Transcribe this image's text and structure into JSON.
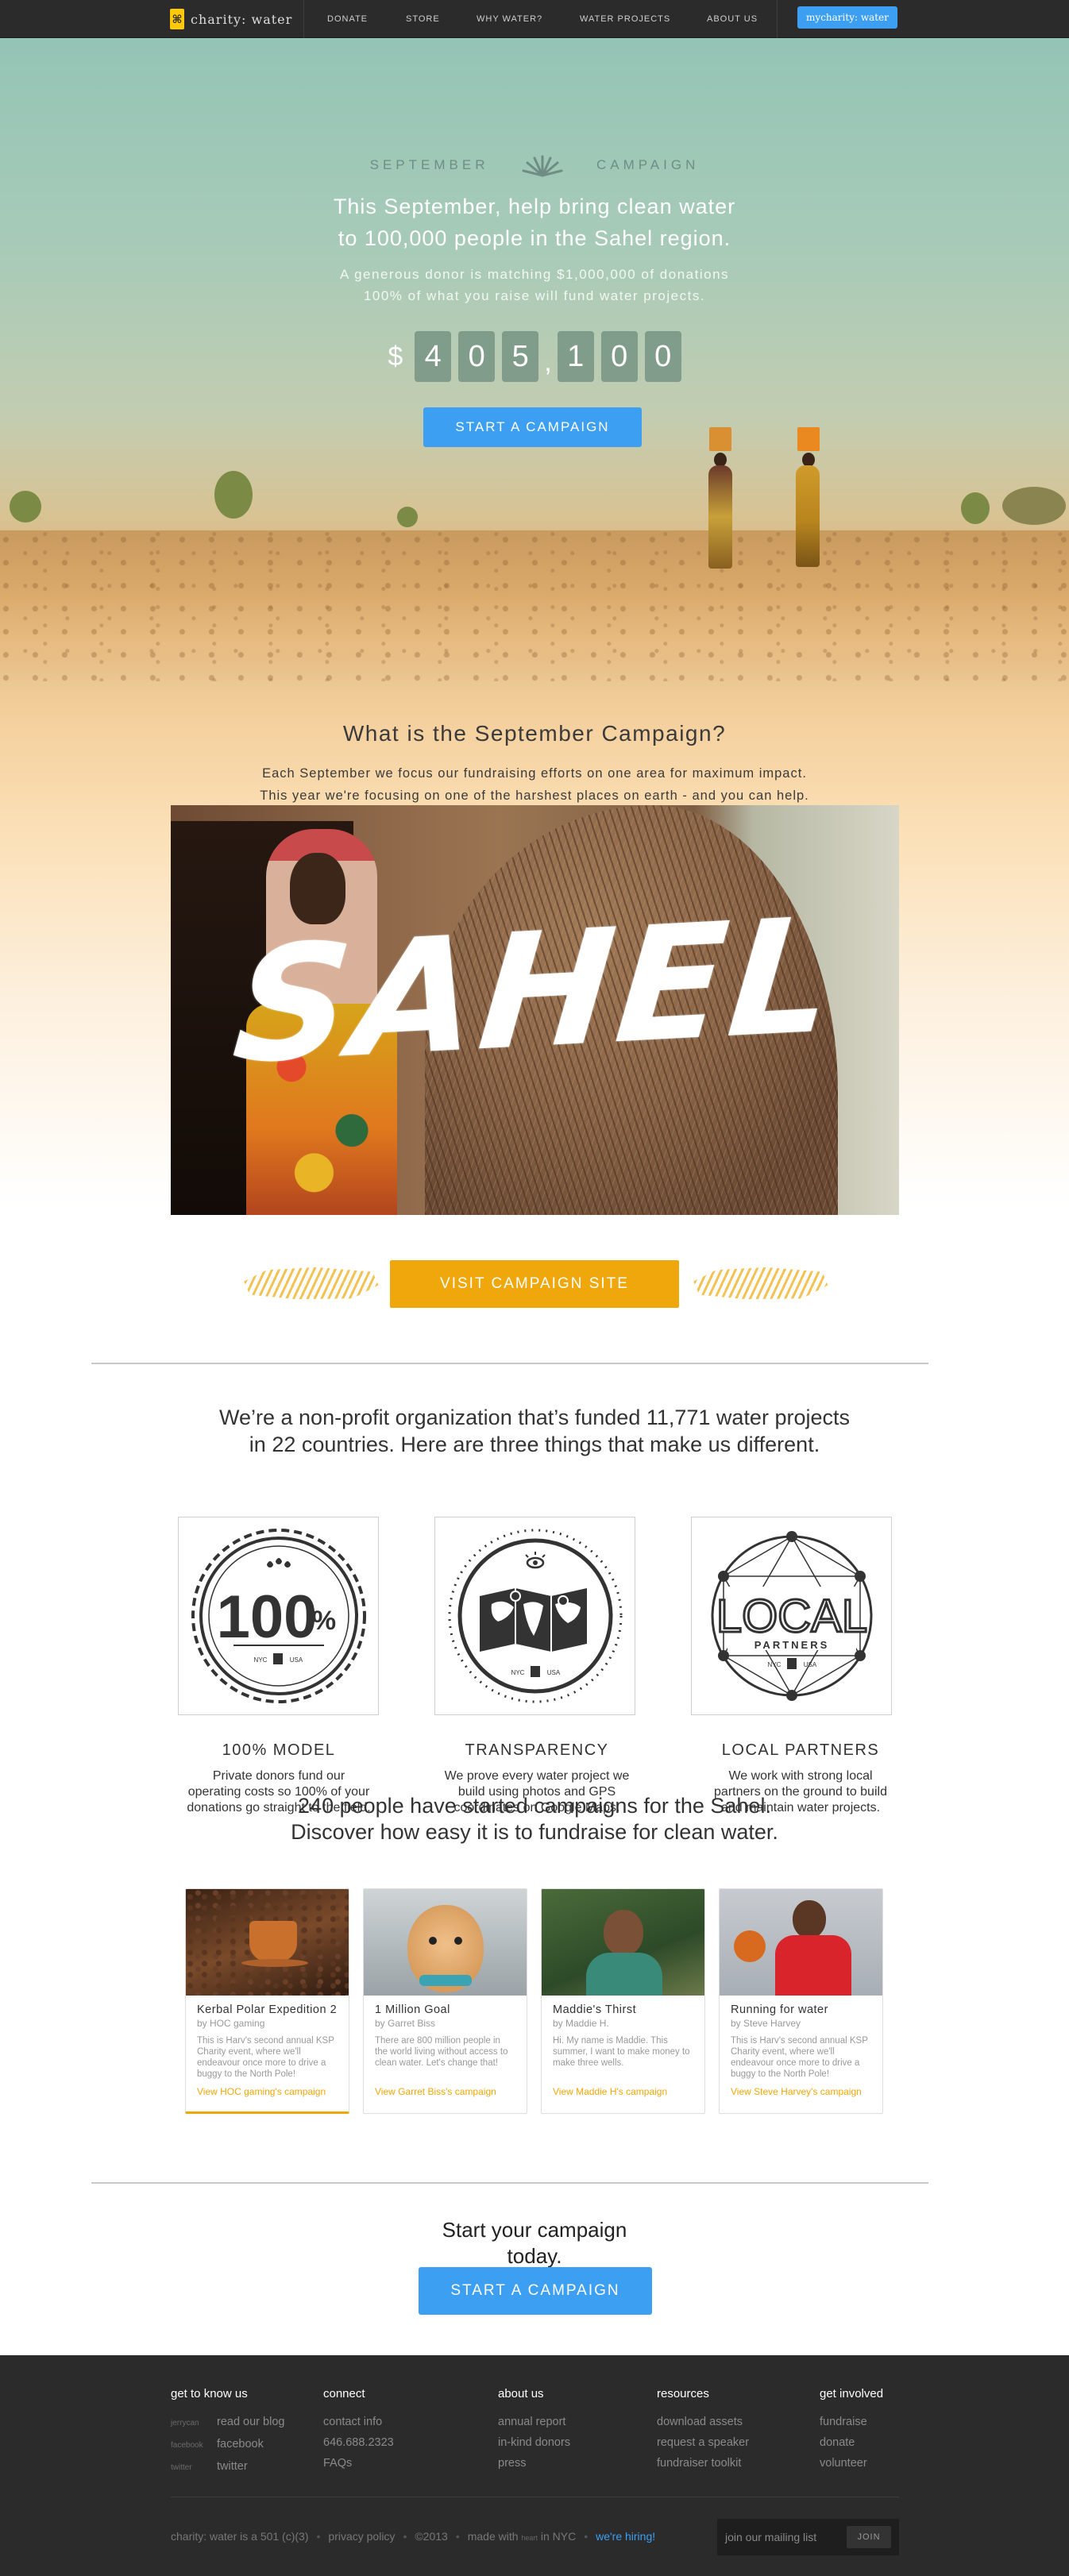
{
  "nav": {
    "logo_text": "charity: water",
    "items": [
      "DONATE",
      "STORE",
      "WHY WATER?",
      "WATER PROJECTS",
      "ABOUT US"
    ],
    "my_button": "mycharity: water"
  },
  "hero": {
    "september": "SEPTEMBER",
    "campaign": "CAMPAIGN",
    "headline_1": "This September, help bring clean water",
    "headline_2": "to 100,000 people in the Sahel region.",
    "sub_1": "A generous donor is matching $1,000,000 of donations",
    "sub_2": "100% of what you raise will fund water projects.",
    "counter": {
      "dollar": "$",
      "digits": [
        "4",
        "0",
        "5",
        "1",
        "0",
        "0"
      ],
      "comma": ","
    },
    "cta": "START A CAMPAIGN"
  },
  "what": {
    "title": "What is the September Campaign?",
    "body_1": "Each September we focus our fundraising efforts on one area for maximum impact.",
    "body_2": "This year we're focusing on one of the harshest places on earth - and you can help."
  },
  "sahel_word": "SAHEL",
  "visit_button": "VISIT CAMPAIGN SITE",
  "nonprofit": {
    "line_1": "We’re a non-profit organization that’s funded 11,771 water projects",
    "line_2": "in 22 countries. Here are three things that make us different."
  },
  "badges": [
    {
      "title": "100% MODEL",
      "badge_text": "100",
      "text_1": "Private donors fund our",
      "text_2": "operating costs so 100% of your",
      "text_3": "donations go straight to the field."
    },
    {
      "title": "TRANSPARENCY",
      "text_1": "We prove every water project we",
      "text_2": "build using photos and GPS",
      "text_3": "coordinates on Google Maps."
    },
    {
      "title": "LOCAL PARTNERS",
      "badge_text": "LOCAL",
      "badge_sub": "PARTNERS",
      "text_1": "We work with strong local",
      "text_2": "partners on the ground to build",
      "text_3": "and maintain water projects."
    }
  ],
  "badge_stamp": {
    "left": "NYC",
    "right": "USA"
  },
  "people": {
    "line_1": "240 people have started campaigns for the Sahel.",
    "line_2": "Discover how easy it is to fundraise for clean water."
  },
  "cards": [
    {
      "title": "Kerbal Polar Expedition 2",
      "by": "by HOC gaming",
      "desc": "This is Harv's second annual KSP Charity event, where we'll endeavour once more to drive a buggy to the North Pole!",
      "link": "View HOC gaming's campaign"
    },
    {
      "title": "1 Million Goal",
      "by": "by Garret Biss",
      "desc": "There are 800 million people in the world living without access to clean water. Let's change that!",
      "link": "View Garret Biss's campaign"
    },
    {
      "title": "Maddie's Thirst",
      "by": "by Maddie H.",
      "desc": "Hi. My name is Maddie. This summer, I want to make money to make three wells.",
      "link": "View Maddie H's campaign"
    },
    {
      "title": "Running for water",
      "by": "by Steve Harvey",
      "desc": "This is Harv's second annual KSP Charity event, where we'll endeavour once more to drive a buggy to the North Pole!",
      "link": "View Steve Harvey's campaign"
    }
  ],
  "start": {
    "line_1": "Start your campaign",
    "line_2": "today.",
    "cta": "START A CAMPAIGN"
  },
  "footer": {
    "col1": {
      "heading": "get to know us",
      "tiny": [
        "jerrycan",
        "facebook",
        "twitter"
      ],
      "links": [
        "read our blog",
        "facebook",
        "twitter"
      ]
    },
    "col2": {
      "heading": "connect",
      "links": [
        "contact info",
        "646.688.2323",
        "FAQs"
      ]
    },
    "col3": {
      "heading": "about us",
      "links": [
        "annual report",
        "in-kind donors",
        "press"
      ]
    },
    "col4": {
      "heading": "resources",
      "links": [
        "download assets",
        "request a speaker",
        "fundraiser toolkit"
      ]
    },
    "col5": {
      "heading": "get involved",
      "links": [
        "fundraise",
        "donate",
        "volunteer"
      ]
    },
    "bottom": {
      "nonprofit": "charity: water is a 501 (c)(3)",
      "privacy": "privacy policy",
      "copyright": "©2013",
      "made_with": "made with",
      "heart": "heart",
      "in_nyc": "in NYC",
      "hiring": "we're hiring!"
    },
    "mailing": {
      "label": "join our mailing list",
      "button": "JOIN"
    }
  },
  "colors": {
    "nav_bg": "#2b2b2b",
    "accent_blue": "#3d9ff2",
    "accent_gold": "#f0a70b",
    "footer_bg": "#2b2b2b"
  }
}
